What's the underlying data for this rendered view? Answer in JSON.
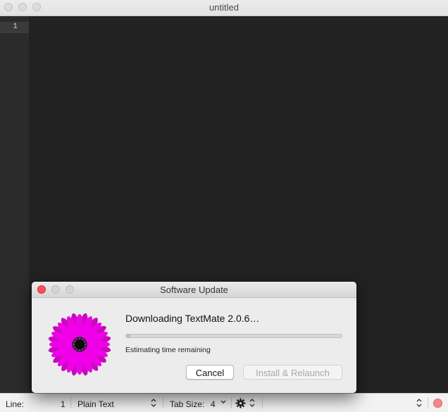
{
  "window": {
    "title": "untitled"
  },
  "editor": {
    "line_numbers": [
      "1"
    ]
  },
  "dialog": {
    "title": "Software Update",
    "heading": "Downloading TextMate 2.0.6…",
    "progress": 0.01,
    "status": "Estimating time remaining",
    "cancel_label": "Cancel",
    "install_label": "Install & Relaunch",
    "icon": "daisy-flower-icon"
  },
  "statusbar": {
    "line_label": "Line:",
    "line_value": "1",
    "grammar": "Plain Text",
    "tab_size_label": "Tab Size:",
    "tab_size_value": "4"
  },
  "colors": {
    "editor_bg": "#222222",
    "gutter_bg": "#2b2b2b",
    "close_red": "#fd4e57",
    "flower_magenta": "#f000e8"
  }
}
